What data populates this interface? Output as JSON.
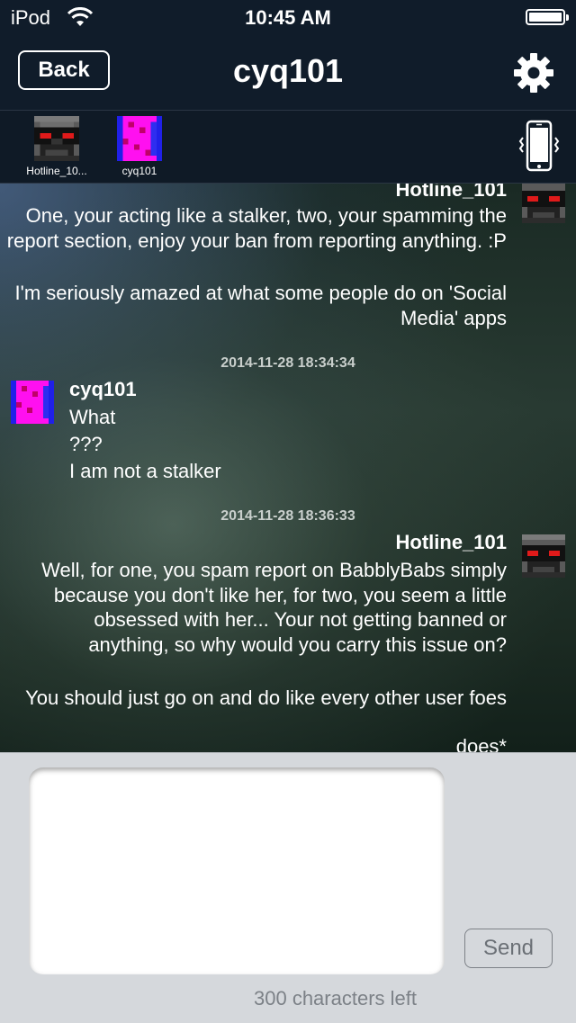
{
  "status_bar": {
    "carrier": "iPod",
    "time": "10:45 AM",
    "battery_level": 1.0
  },
  "nav": {
    "back_label": "Back",
    "title": "cyq101",
    "settings_icon": "gear-icon"
  },
  "participants": [
    {
      "name": "Hotline_10...",
      "avatar": "robot-avatar"
    },
    {
      "name": "cyq101",
      "avatar": "magenta-blue-avatar"
    }
  ],
  "vibrate_icon": "phone-vibrate-icon",
  "messages": [
    {
      "sender": "Hotline_101",
      "side": "right",
      "lines": [
        "One, your acting like a stalker, two, your spamming the report section, enjoy your ban from reporting anything.  :P",
        "I'm seriously amazed at what some people do on 'Social Media' apps"
      ]
    },
    {
      "timestamp": "2014-11-28 18:34:34",
      "sender": "cyq101",
      "side": "left",
      "lines": [
        "What",
        "???",
        "I am not a stalker"
      ]
    },
    {
      "timestamp": "2014-11-28 18:36:33",
      "sender": "Hotline_101",
      "side": "right",
      "lines": [
        "Well, for one, you spam report on BabblyBabs simply because you don't like her, for two, you seem a little obsessed with her... Your not getting banned or anything, so why would you carry this issue on?",
        "You should just go on and do like every other user foes",
        "does*"
      ]
    }
  ],
  "composer": {
    "value": "",
    "send_label": "Send",
    "chars_left": "300 characters left"
  },
  "colors": {
    "bar_background": "#101c2a",
    "input_area": "#d5d8dc",
    "avatar_magenta": "#ff00ff",
    "avatar_blue": "#1e1ee6"
  }
}
